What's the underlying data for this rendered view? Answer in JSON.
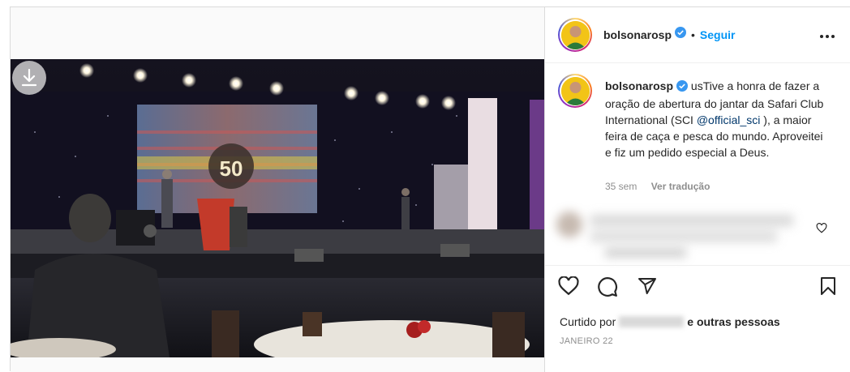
{
  "post": {
    "username": "bolsonarosp",
    "follow_label": "Seguir",
    "separator": "•",
    "caption_prefix": "us",
    "caption_text_1": "Tive a honra de fazer a oração de abertura do jantar da Safari Club International (SCI ",
    "caption_mention": "@official_sci",
    "caption_text_2": " ), a maior feira de caça e pesca do mundo. Aproveitei e fiz um pedido especial a Deus.",
    "time_ago": "35 sem",
    "translate_label": "Ver tradução",
    "liked_prefix": "Curtido por",
    "liked_suffix": "e outras pessoas",
    "date": "JANEIRO 22"
  },
  "video": {
    "screen_badge": "50"
  },
  "icons": {
    "download": "download-icon",
    "verified": "verified-badge-icon",
    "more": "more-options-icon",
    "like": "heart-icon",
    "comment": "comment-icon",
    "share": "share-icon",
    "save": "bookmark-icon",
    "comment_like": "heart-small-icon"
  },
  "colors": {
    "accent": "#0095f6",
    "mention": "#00376b",
    "muted": "#8e8e8e",
    "avatar_bg": "#f2c417"
  }
}
